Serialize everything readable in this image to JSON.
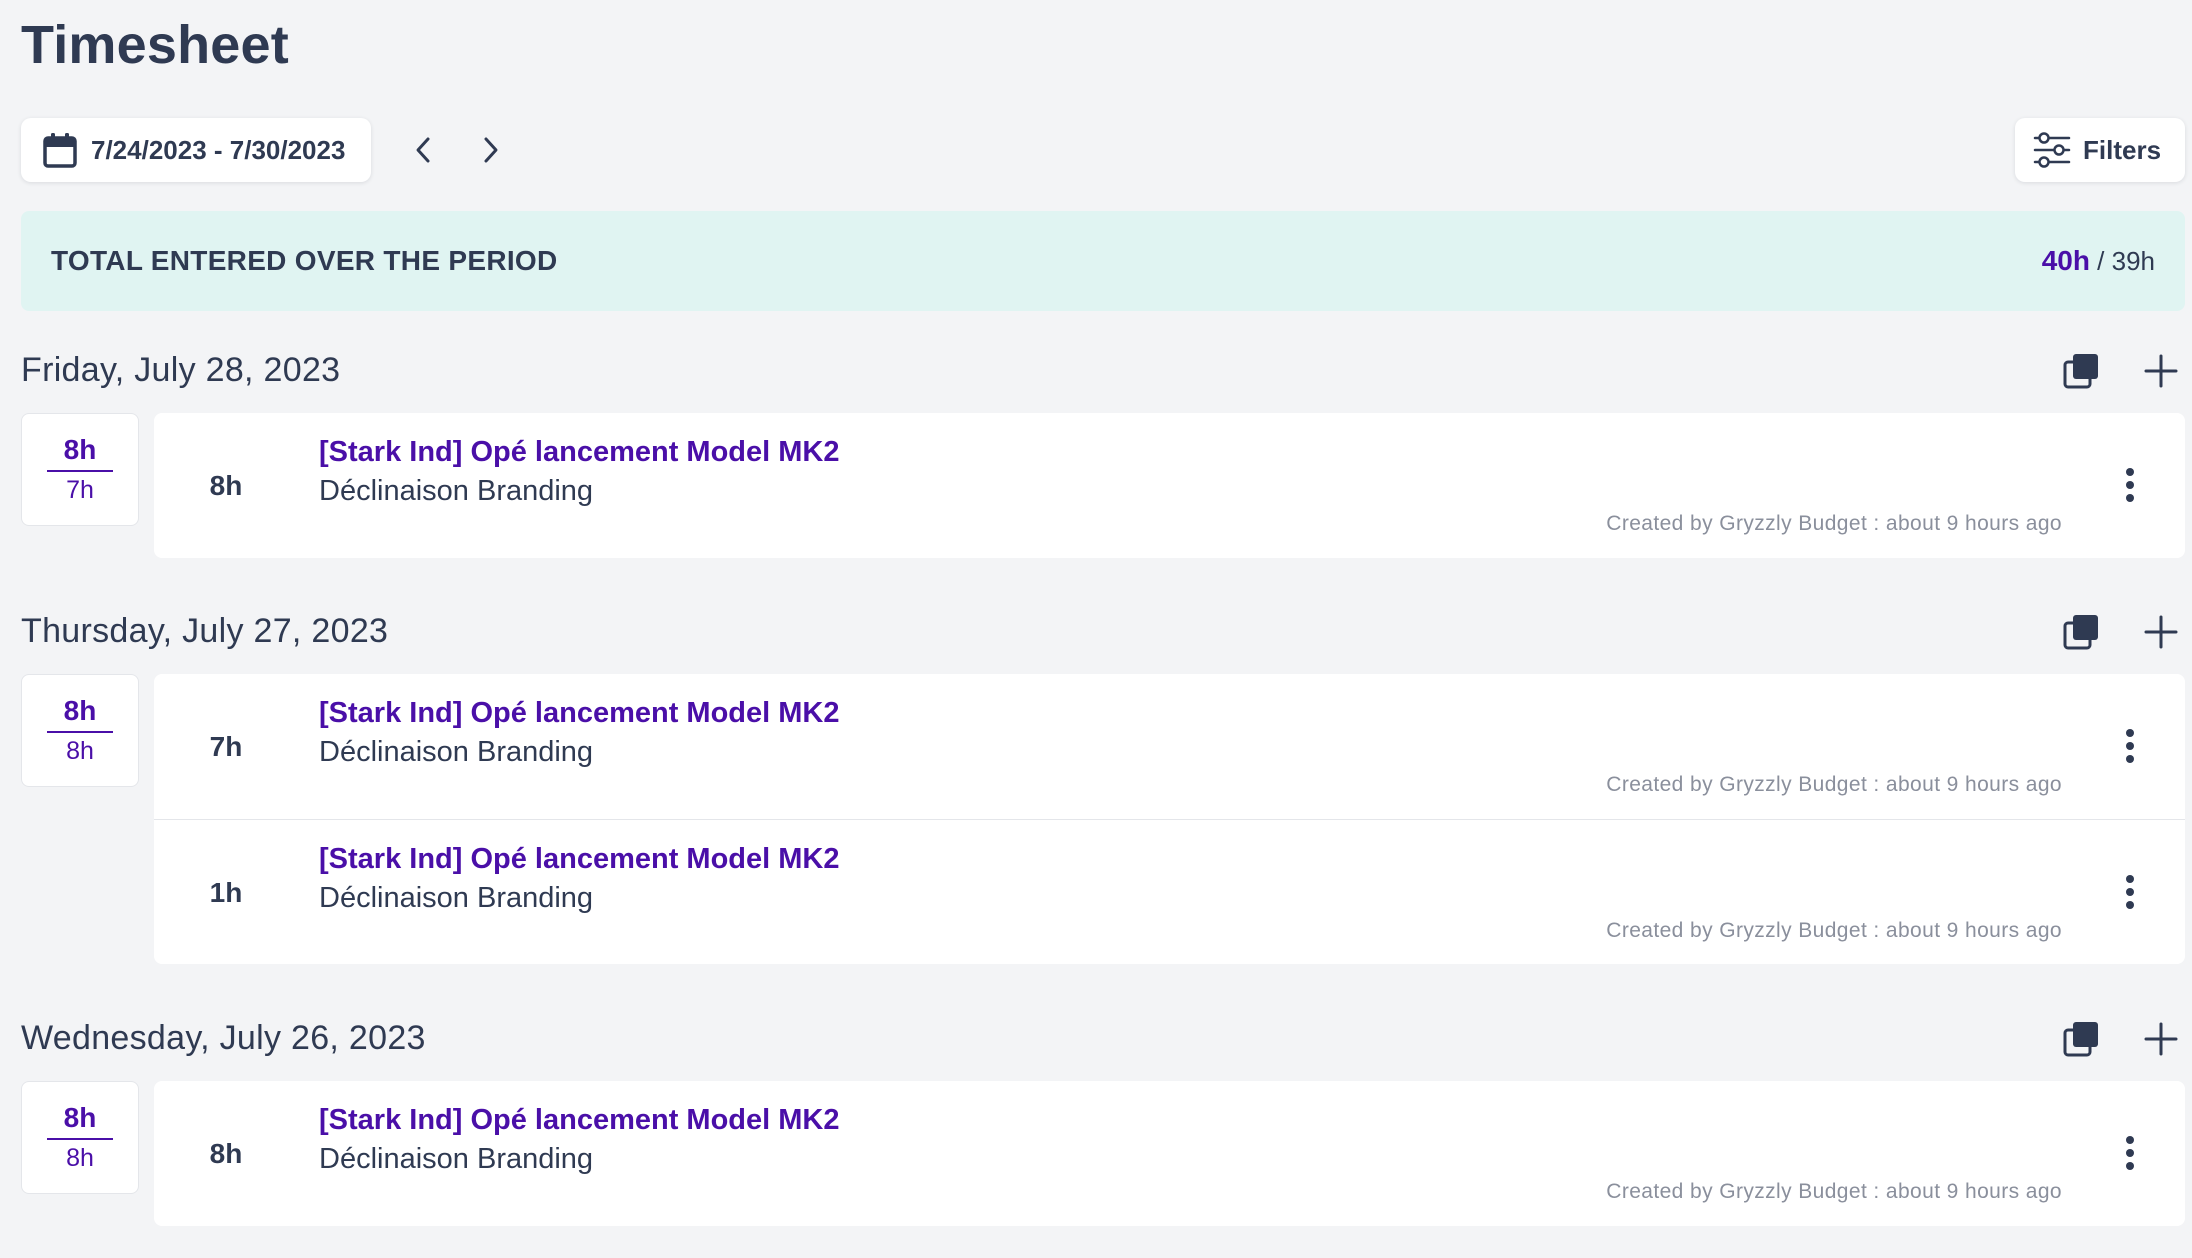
{
  "header": {
    "title": "Timesheet"
  },
  "toolbar": {
    "date_range": "7/24/2023 - 7/30/2023",
    "prev_icon": "chevron-left-icon",
    "next_icon": "chevron-right-icon",
    "filters_label": "Filters",
    "filters_icon": "sliders-icon"
  },
  "total": {
    "title": "TOTAL ENTERED OVER THE PERIOD",
    "entered": "40h",
    "separator": " / ",
    "expected": "39h"
  },
  "colors": {
    "accent": "#4a0fa8",
    "text": "#2f3a52",
    "banner": "#e0f4f2",
    "background": "#f3f4f6",
    "muted": "#8a8f9c"
  },
  "days": [
    {
      "title": "Friday, July 28, 2023",
      "entered": "8h",
      "expected": "7h",
      "entries": [
        {
          "hours": "8h",
          "project": "[Stark Ind] Opé lancement Model MK2",
          "task": "Déclinaison Branding",
          "meta": "Created by Gryzzly Budget : about 9 hours ago"
        }
      ]
    },
    {
      "title": "Thursday, July 27, 2023",
      "entered": "8h",
      "expected": "8h",
      "entries": [
        {
          "hours": "7h",
          "project": "[Stark Ind] Opé lancement Model MK2",
          "task": "Déclinaison Branding",
          "meta": "Created by Gryzzly Budget : about 9 hours ago"
        },
        {
          "hours": "1h",
          "project": "[Stark Ind] Opé lancement Model MK2",
          "task": "Déclinaison Branding",
          "meta": "Created by Gryzzly Budget : about 9 hours ago"
        }
      ]
    },
    {
      "title": "Wednesday, July 26, 2023",
      "entered": "8h",
      "expected": "8h",
      "entries": [
        {
          "hours": "8h",
          "project": "[Stark Ind] Opé lancement Model MK2",
          "task": "Déclinaison Branding",
          "meta": "Created by Gryzzly Budget : about 9 hours ago"
        }
      ]
    }
  ]
}
